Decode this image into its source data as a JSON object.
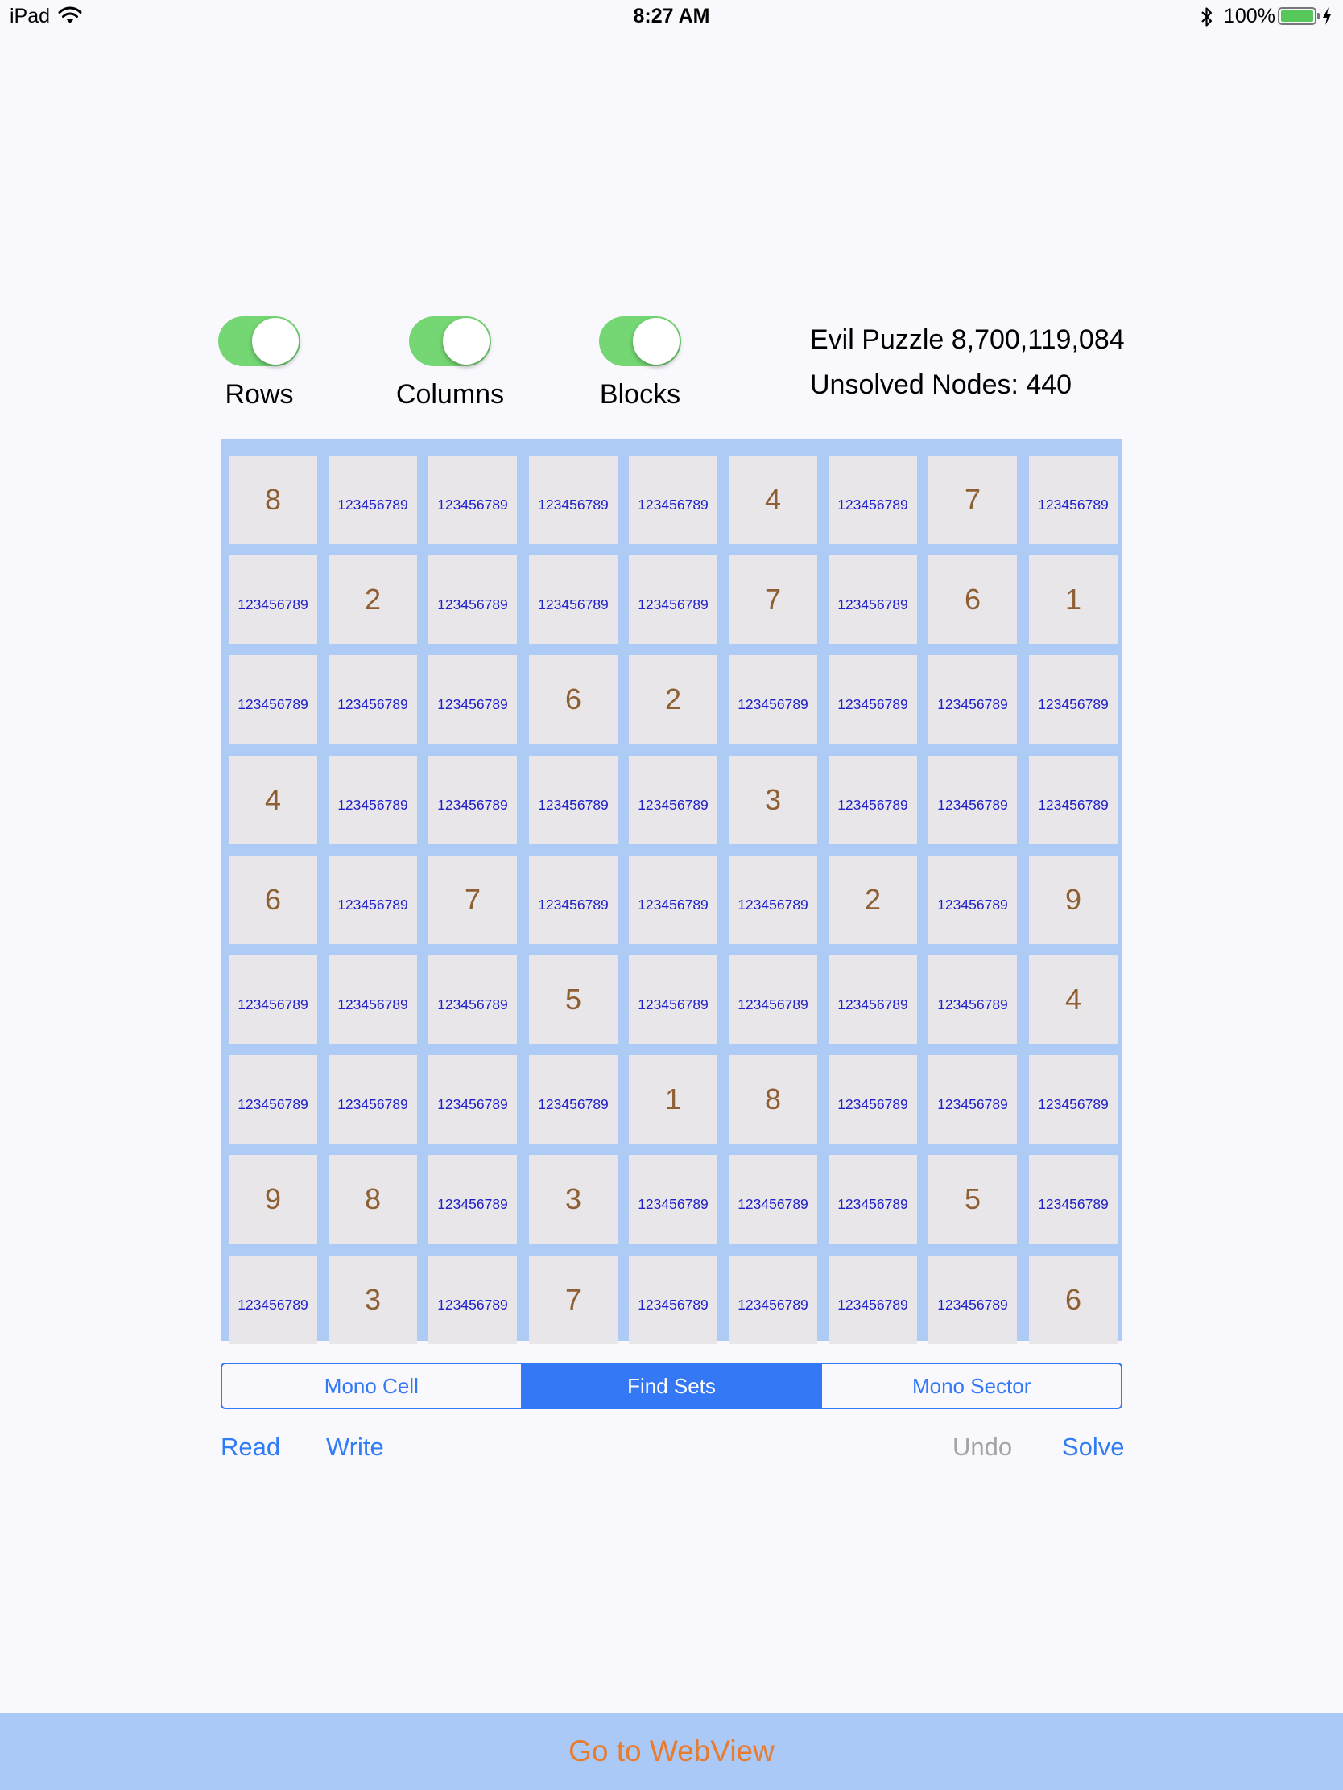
{
  "status_bar": {
    "device": "iPad",
    "time": "8:27 AM",
    "battery": "100%"
  },
  "toggles": [
    {
      "label": "Rows",
      "on": true
    },
    {
      "label": "Columns",
      "on": true
    },
    {
      "label": "Blocks",
      "on": true
    }
  ],
  "info": {
    "puzzle_title": "Evil Puzzle 8,700,119,084",
    "unsolved_nodes": "Unsolved Nodes: 440"
  },
  "board": {
    "candidate_text": "123456789",
    "rows": [
      [
        "8",
        "",
        "",
        "",
        "",
        "4",
        "",
        "7",
        ""
      ],
      [
        "",
        "2",
        "",
        "",
        "",
        "7",
        "",
        "6",
        "1"
      ],
      [
        "",
        "",
        "",
        "6",
        "2",
        "",
        "",
        "",
        ""
      ],
      [
        "4",
        "",
        "",
        "",
        "",
        "3",
        "",
        "",
        ""
      ],
      [
        "6",
        "",
        "7",
        "",
        "",
        "",
        "2",
        "",
        "9"
      ],
      [
        "",
        "",
        "",
        "5",
        "",
        "",
        "",
        "",
        "4"
      ],
      [
        "",
        "",
        "",
        "",
        "1",
        "8",
        "",
        "",
        ""
      ],
      [
        "9",
        "8",
        "",
        "3",
        "",
        "",
        "",
        "5",
        ""
      ],
      [
        "",
        "3",
        "",
        "7",
        "",
        "",
        "",
        "",
        "6"
      ]
    ]
  },
  "segments": {
    "items": [
      "Mono Cell",
      "Find Sets",
      "Mono Sector"
    ],
    "selected": "Find Sets"
  },
  "actions": {
    "read": "Read",
    "write": "Write",
    "undo": "Undo",
    "solve": "Solve"
  },
  "bottom_bar": {
    "label": "Go to WebView"
  },
  "colors": {
    "toggle_on": "#74d773",
    "board_background": "#aecbf6",
    "cell_background": "#e8e6e8",
    "given_digit": "#8e5f33",
    "candidate_digit": "#1e1ec8",
    "accent": "#3478f6",
    "bottom_bar_background": "#aac9f7",
    "bottom_bar_text": "#e77b2e"
  }
}
